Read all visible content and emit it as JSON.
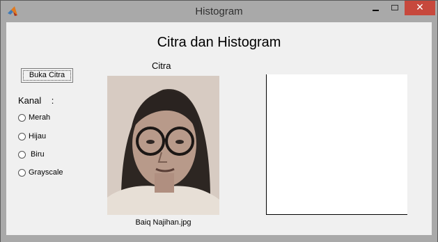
{
  "window": {
    "title": "Histogram"
  },
  "icons": {
    "app": "matlab-icon",
    "minimize": "minimize-icon",
    "maximize": "maximize-icon",
    "close": "close-icon"
  },
  "colors": {
    "close_button": "#c7483c",
    "client_background": "#f0f0f0",
    "frame": "#a9a9a9"
  },
  "main": {
    "heading": "Citra dan Histogram",
    "load_button": "Buka Citra",
    "channel_label": "Kanal    :",
    "channels": [
      {
        "label": "Merah",
        "selected": false
      },
      {
        "label": "Hijau",
        "selected": false
      },
      {
        "label": " Biru",
        "selected": false
      },
      {
        "label": "Grayscale",
        "selected": false
      }
    ],
    "image_label": "Citra",
    "image_file": "Baiq Najihan.jpg"
  }
}
